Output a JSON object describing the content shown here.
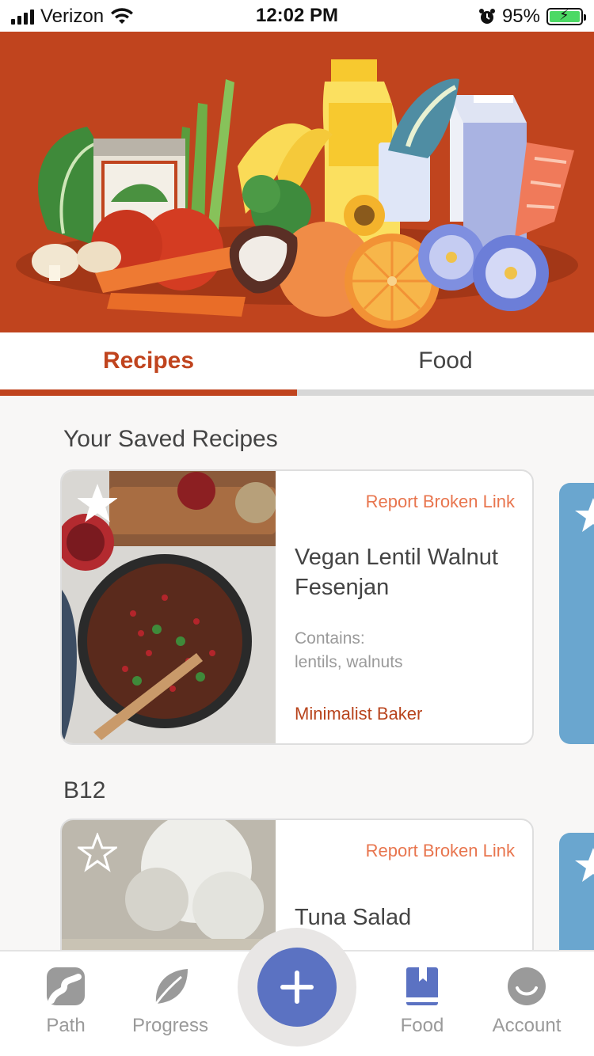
{
  "status_bar": {
    "carrier": "Verizon",
    "time": "12:02 PM",
    "battery": "95%"
  },
  "tabs": [
    {
      "label": "Recipes",
      "active": true
    },
    {
      "label": "Food",
      "active": false
    }
  ],
  "sections": [
    {
      "title": "Your Saved Recipes",
      "card": {
        "report_link": "Report Broken Link",
        "title": "Vegan Lentil Walnut Fesenjan",
        "contains_label": "Contains:",
        "contains_value": "lentils, walnuts",
        "source": "Minimalist Baker"
      }
    },
    {
      "title": "B12",
      "card": {
        "report_link": "Report Broken Link",
        "title": "Tuna Salad"
      }
    }
  ],
  "bottom_nav": [
    {
      "label": "Path",
      "icon": "path-icon",
      "active": false
    },
    {
      "label": "Progress",
      "icon": "leaf-icon",
      "active": false
    },
    {
      "label": "Food",
      "icon": "book-icon",
      "active": true
    },
    {
      "label": "Account",
      "icon": "account-icon",
      "active": false
    }
  ],
  "colors": {
    "brand": "#c0441e",
    "accent_blue": "#5b72c2",
    "link_orange": "#e8754e"
  }
}
